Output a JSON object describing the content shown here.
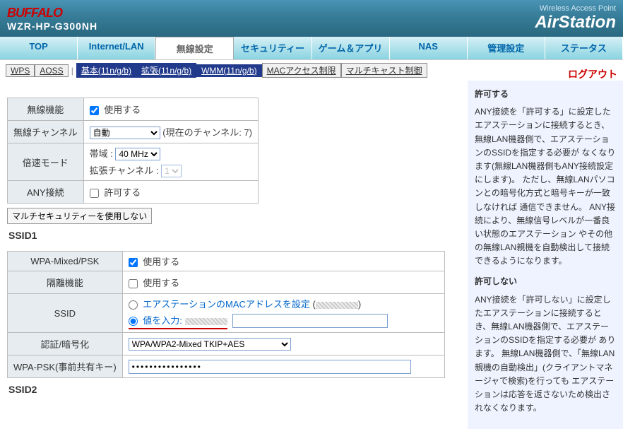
{
  "header": {
    "brand": "BUFFALO",
    "model": "WZR-HP-G300NH",
    "wap": "Wireless Access Point",
    "product": "AirStation"
  },
  "main_tabs": [
    "TOP",
    "Internet/LAN",
    "無線設定",
    "セキュリティー",
    "ゲーム＆アプリ",
    "NAS",
    "管理設定",
    "ステータス"
  ],
  "main_active": 2,
  "sub_tabs": {
    "wps": "WPS",
    "aoss": "AOSS",
    "basic": "基本(11n/g/b)",
    "ext": "拡張(11n/g/b)",
    "wmm": "WMM(11n/g/b)",
    "mac": "MACアクセス制限",
    "multi": "マルチキャスト制御"
  },
  "logout": "ログアウト",
  "wireless": {
    "radio_label": "無線機能",
    "radio_use": "使用する",
    "channel_label": "無線チャンネル",
    "channel_select": "自動",
    "channel_note": "(現在のチャンネル: 7)",
    "double_label": "倍速モード",
    "bandwidth_label": "帯域 :",
    "bandwidth_value": "40 MHz",
    "ext_ch_label": "拡張チャンネル :",
    "ext_ch_value": "1",
    "any_label": "ANY接続",
    "any_allow": "許可する"
  },
  "multi_sec_btn": "マルチセキュリティーを使用しない",
  "ssid1": {
    "heading": "SSID1",
    "wpa_mixed_label": "WPA-Mixed/PSK",
    "wpa_mixed_use": "使用する",
    "isolation_label": "隔離機能",
    "isolation_use": "使用する",
    "ssid_label": "SSID",
    "ssid_mac_opt": "エアステーションのMACアドレスを設定",
    "ssid_input_opt": "値を入力:",
    "auth_label": "認証/暗号化",
    "auth_value": "WPA/WPA2-Mixed TKIP+AES",
    "psk_label": "WPA-PSK(事前共有キー)",
    "psk_value": "••••••••••••••••"
  },
  "ssid2_heading": "SSID2",
  "side": {
    "allow_h": "許可する",
    "allow_p": "ANY接続を「許可する」に設定したエアステーションに接続するとき、無線LAN機器側で、エアステーションのSSIDを指定する必要が なくなります(無線LAN機器側もANY接続設定にします)。\nただし、無線LANパソコンとの暗号化方式と暗号キーが一致しなければ 通信できません。\nANY接続により、無線信号レベルが一番良い状態のエアステーション やその他の無線LAN親機を自動検出して接続できるようになります。",
    "deny_h": "許可しない",
    "deny_p": "ANY接続を「許可しない」に設定したエアステーションに接続するとき、無線LAN機器側で、エアステーションのSSIDを指定する必要が あります。\n無線LAN機器側で、「無線LAN親機の自動検出」(クライアントマネージャで検索)を行っても エアステーションは応答を返さないため検出されなくなります。"
  }
}
